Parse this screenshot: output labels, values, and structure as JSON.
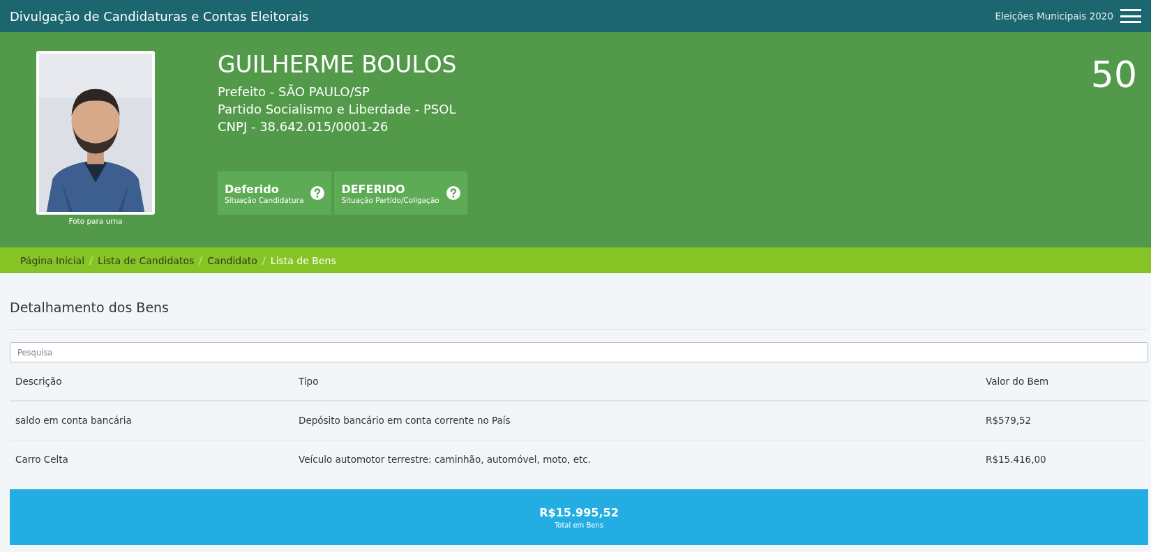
{
  "top_bar": {
    "title": "Divulgação de Candidaturas e Contas Eleitorais",
    "election": "Eleições Municipais 2020"
  },
  "candidate": {
    "photo": {
      "caption": "Foto para urna"
    },
    "name": "GUILHERME BOULOS",
    "lines": [
      "Prefeito - SÃO PAULO/SP",
      "Partido Socialismo e Liberdade - PSOL",
      "CNPJ - 38.642.015/0001-26"
    ],
    "number": "50",
    "badges": [
      {
        "value": "Deferido",
        "label": "Situação Candidatura"
      },
      {
        "value": "DEFERIDO",
        "label": "Situação Partido/Coligação"
      }
    ]
  },
  "breadcrumb": [
    {
      "label": "Página Inicial",
      "selected": false
    },
    {
      "label": "Lista de Candidatos",
      "selected": false
    },
    {
      "label": "Candidato",
      "selected": false
    },
    {
      "label": "Lista de Bens",
      "selected": true
    }
  ],
  "section_title": "Detalhamento dos Bens",
  "search": {
    "placeholder": "Pesquisa"
  },
  "table": {
    "columns": [
      "Descrição",
      "Tipo",
      "Valor do Bem"
    ],
    "rows": [
      [
        "saldo em conta bancária",
        "Depósito bancário em conta corrente no País",
        "R$579,52"
      ],
      [
        "Carro Celta",
        "Veículo automotor terrestre: caminhão, automóvel, moto, etc.",
        "R$15.416,00"
      ]
    ]
  },
  "total": {
    "value": "R$15.995,52",
    "label": "Total em Bens"
  }
}
